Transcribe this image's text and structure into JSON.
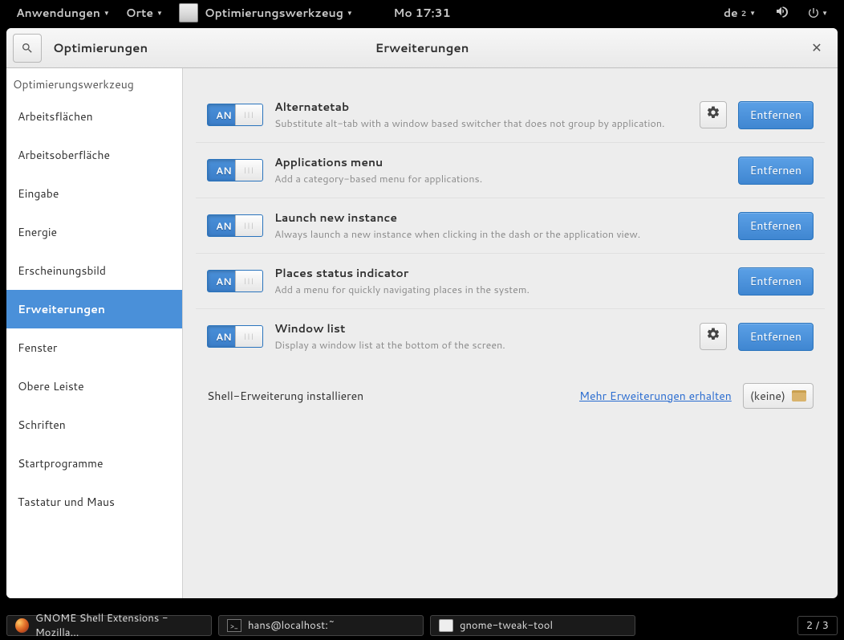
{
  "panel": {
    "applications": "Anwendungen",
    "places": "Orte",
    "app_menu": "Optimierungswerkzeug",
    "clock": "Mo 17:31",
    "keyboard": "de",
    "keyboard_sub": "2"
  },
  "window": {
    "app_title": "Optimierungen",
    "page_title": "Erweiterungen",
    "close": "✕"
  },
  "sidebar": {
    "header": "Optimierungswerkzeug",
    "items": [
      "Arbeitsflächen",
      "Arbeitsoberfläche",
      "Eingabe",
      "Energie",
      "Erscheinungsbild",
      "Erweiterungen",
      "Fenster",
      "Obere Leiste",
      "Schriften",
      "Startprogramme",
      "Tastatur und Maus"
    ],
    "active_index": 5
  },
  "toggle_on_label": "AN",
  "remove_label": "Entfernen",
  "extensions": [
    {
      "name": "Alternatetab",
      "desc": "Substitute alt-tab with a window based switcher that does not group by application.",
      "has_settings": true
    },
    {
      "name": "Applications menu",
      "desc": "Add a category-based menu for applications.",
      "has_settings": false
    },
    {
      "name": "Launch new instance",
      "desc": "Always launch a new instance when clicking in the dash or the application view.",
      "has_settings": false
    },
    {
      "name": "Places status indicator",
      "desc": "Add a menu for quickly navigating places in the system.",
      "has_settings": false
    },
    {
      "name": "Window list",
      "desc": "Display a window list at the bottom of the screen.",
      "has_settings": true
    }
  ],
  "install": {
    "label": "Shell-Erweiterung installieren",
    "more_link": "Mehr Erweiterungen erhalten",
    "none": "(keine)"
  },
  "taskbar": {
    "firefox": "GNOME Shell Extensions - Mozilla...",
    "terminal": "hans@localhost:~",
    "tweak": "gnome-tweak-tool",
    "workspace": "2 / 3"
  }
}
